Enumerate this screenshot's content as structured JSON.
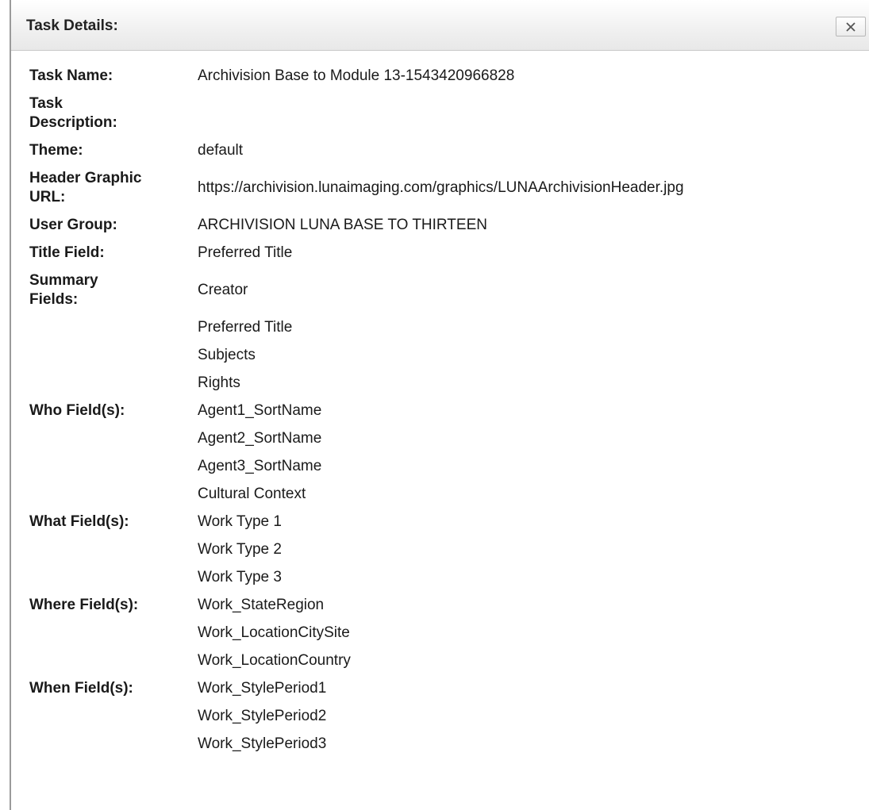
{
  "dialog": {
    "title": "Task Details:",
    "close_label": "Close"
  },
  "fields": {
    "task_name": {
      "label": "Task Name:",
      "value": "Archivision Base to Module 13-1543420966828"
    },
    "task_description": {
      "label_line1": "Task",
      "label_line2": "Description:",
      "value": ""
    },
    "theme": {
      "label": "Theme:",
      "value": "default"
    },
    "header_graphic_url": {
      "label_line1": "Header Graphic",
      "label_line2": "URL:",
      "value": "https://archivision.lunaimaging.com/graphics/LUNAArchivisionHeader.jpg"
    },
    "user_group": {
      "label": "User Group:",
      "value": "ARCHIVISION LUNA BASE TO THIRTEEN"
    },
    "title_field": {
      "label": "Title Field:",
      "value": "Preferred Title"
    },
    "summary_fields": {
      "label_line1": "Summary",
      "label_line2": "Fields:",
      "values": [
        "Creator",
        "Preferred Title",
        "Subjects",
        "Rights"
      ]
    },
    "who_fields": {
      "label": "Who Field(s):",
      "values": [
        "Agent1_SortName",
        "Agent2_SortName",
        "Agent3_SortName",
        "Cultural Context"
      ]
    },
    "what_fields": {
      "label": "What Field(s):",
      "values": [
        "Work Type 1",
        "Work Type 2",
        "Work Type 3"
      ]
    },
    "where_fields": {
      "label": "Where Field(s):",
      "values": [
        "Work_StateRegion",
        "Work_LocationCitySite",
        "Work_LocationCountry"
      ]
    },
    "when_fields": {
      "label": "When Field(s):",
      "values": [
        "Work_StylePeriod1",
        "Work_StylePeriod2",
        "Work_StylePeriod3"
      ]
    }
  }
}
